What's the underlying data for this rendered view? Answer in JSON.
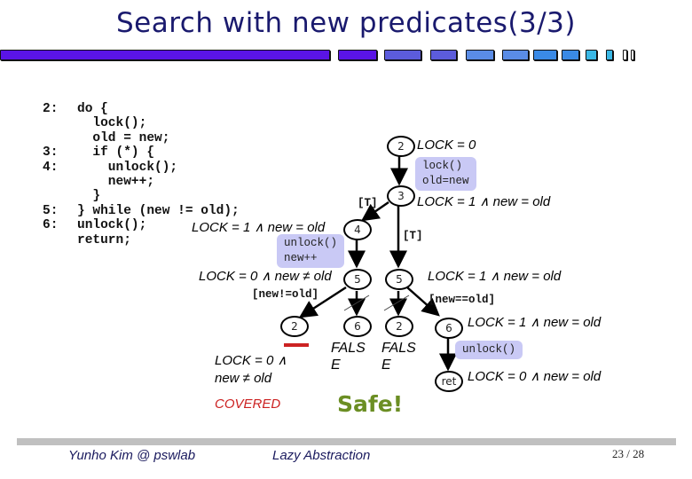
{
  "slide": {
    "title": "Search with new predicates(3/3)",
    "colors": {
      "title": "#1a1a6e",
      "op_box": "#c9c9f5",
      "covered": "#cc2222",
      "safe": "#6b8e23",
      "footer_text": "#1a1a5e",
      "footer_bar": "#c0c0c0"
    }
  },
  "code": {
    "line_numbers": [
      "2:",
      "",
      "",
      "3:",
      "4:",
      "",
      "",
      "5:",
      "6:",
      ""
    ],
    "lines": [
      "do {",
      "  lock();",
      "  old = new;",
      "  if (*) {",
      "    unlock();",
      "    new++;",
      "  }",
      "} while (new != old);",
      "unlock();",
      "return;"
    ]
  },
  "tree": {
    "nodes": {
      "n2_root": "2",
      "n3": "3",
      "n4": "4",
      "n5_left": "5",
      "n5_right": "5",
      "n2_covered": "2",
      "n6_false": "6",
      "n2_false": "2",
      "n6": "6",
      "ret": "ret"
    },
    "predicates": {
      "n2_root": "LOCK = 0",
      "n3": "LOCK = 1 ∧ new = old",
      "n4": "LOCK = 1 ∧ new = old",
      "n5_left": "LOCK = 0 ∧ new ≠ old",
      "n5_right": "LOCK = 1 ∧ new = old",
      "n6": "LOCK = 1 ∧ new = old",
      "ret": "LOCK = 0 ∧ new = old",
      "n2_covered_line1": "LOCK = 0 ∧",
      "n2_covered_line2": "new ≠ old"
    },
    "ops": {
      "n2_to_n3": [
        "lock()",
        "old=new"
      ],
      "n4_to_n5": [
        "unlock()",
        "new++"
      ],
      "n6_to_ret": [
        "unlock()"
      ]
    },
    "guards": {
      "n3_to_n4": "[T]",
      "n3_to_n5": "[T]",
      "n5_left_to_n2": "[new!=old]",
      "n5_right_to_n6": "[new==old]"
    },
    "false_labels": {
      "n6_false": [
        "FALS",
        "E"
      ],
      "n2_false": [
        "FALS",
        "E"
      ]
    },
    "covered_label": "COVERED",
    "result": "Safe!"
  },
  "footer": {
    "author": "Yunho Kim @ pswlab",
    "topic": "Lazy Abstraction",
    "page": "23 / 28"
  }
}
